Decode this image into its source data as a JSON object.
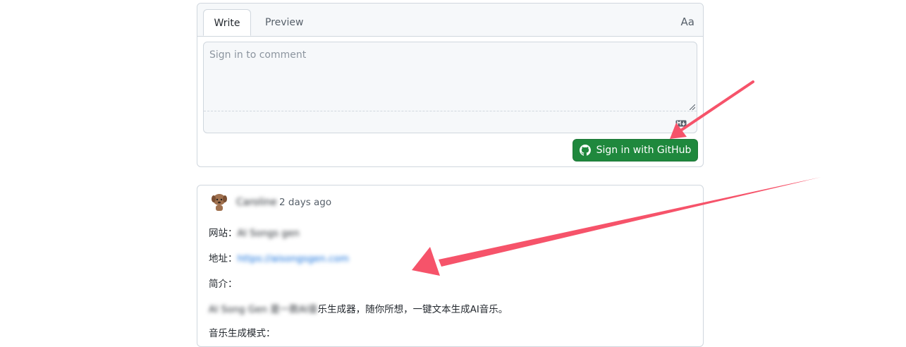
{
  "editor": {
    "tabs": [
      {
        "label": "Write",
        "active": true
      },
      {
        "label": "Preview",
        "active": false
      }
    ],
    "font_toggle": "Aa",
    "placeholder": "Sign in to comment",
    "signin_label": "Sign in with GitHub"
  },
  "comment": {
    "author": "Caroline",
    "time": "2 days ago",
    "website_label": "网站：",
    "website_value": "AI Songs gen",
    "address_label": "地址：",
    "address_value": "https://aisongsgen.com",
    "intro_label": "简介：",
    "intro_blurred": "AI Song Gen 是一款AI音",
    "intro_text": "乐生成器，随你所想，一键文本生成AI音乐。",
    "music_mode_label": "音乐生成模式："
  },
  "colors": {
    "signin_button": "#1f883d",
    "annotation_arrow": "#f6536a",
    "link": "#0969da"
  }
}
